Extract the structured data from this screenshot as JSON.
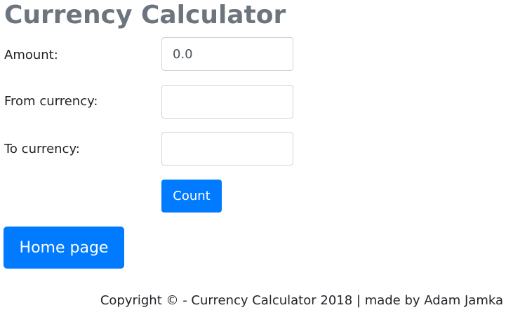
{
  "header": {
    "title": "Currency Calculator"
  },
  "form": {
    "amount": {
      "label": "Amount:",
      "value": "0.0"
    },
    "from_currency": {
      "label": "From currency:",
      "value": ""
    },
    "to_currency": {
      "label": "To currency:",
      "value": ""
    },
    "count_label": "Count"
  },
  "nav": {
    "home_label": "Home page"
  },
  "footer": {
    "text": "Copyright © - Currency Calculator 2018 | made by Adam Jamka"
  },
  "colors": {
    "primary": "#007bff",
    "title": "#6c757d",
    "input_border": "#ced4da"
  }
}
